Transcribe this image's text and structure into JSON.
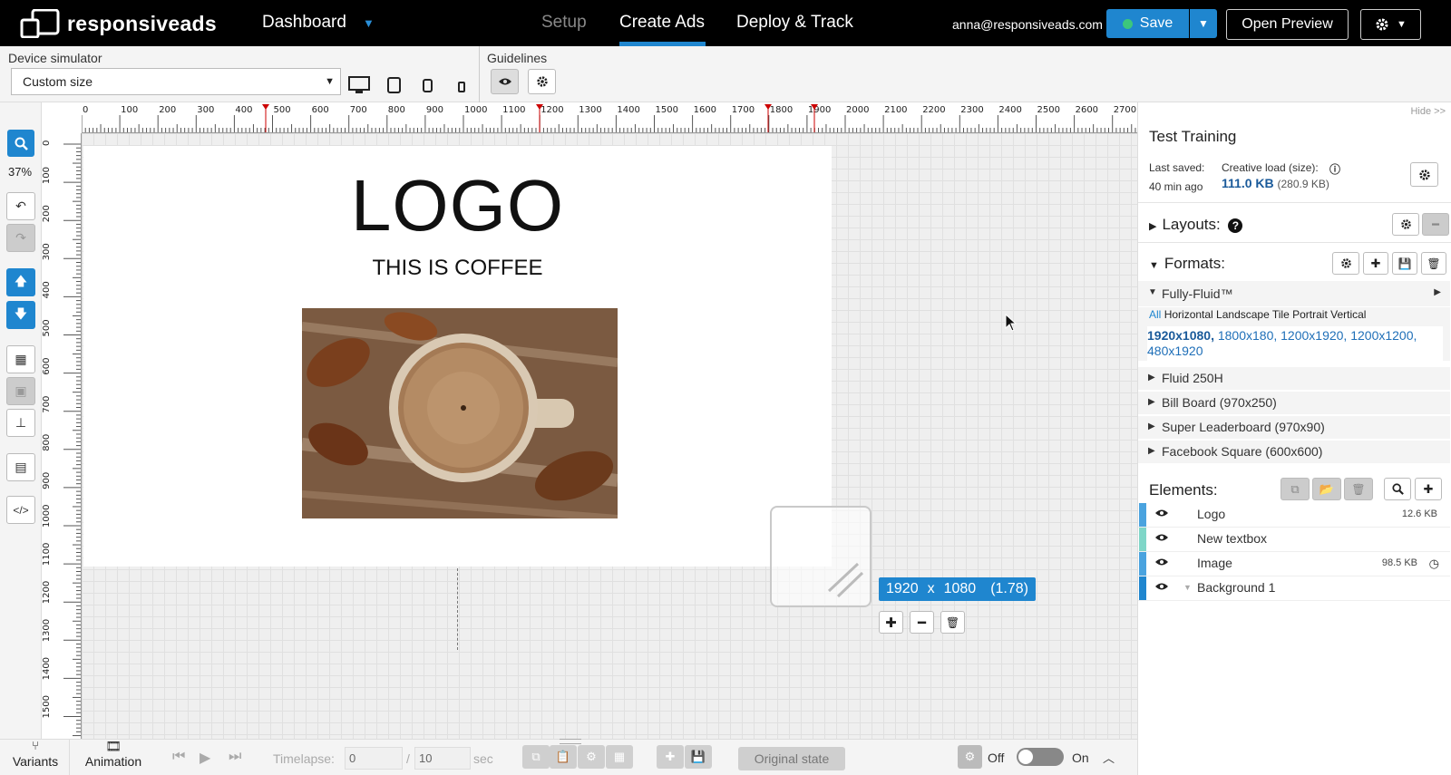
{
  "brand": {
    "name": "responsiveads"
  },
  "topnav": {
    "dashboard": "Dashboard",
    "tabs": [
      {
        "label": "Setup",
        "active": false
      },
      {
        "label": "Create Ads",
        "active": true
      },
      {
        "label": "Deploy & Track",
        "active": false
      }
    ],
    "email": "anna@responsiveads.com",
    "save": "Save",
    "open_preview": "Open Preview"
  },
  "toolbar": {
    "device_label": "Device simulator",
    "device_value": "Custom size",
    "guidelines_label": "Guidelines",
    "devices": [
      "desktop-icon",
      "tablet-icon",
      "phone-icon",
      "small-phone-icon"
    ]
  },
  "left_tools": {
    "zoom": "37%"
  },
  "ruler": {
    "top_ticks": [
      "0",
      "100",
      "200",
      "300",
      "400",
      "500",
      "600",
      "700",
      "800",
      "900",
      "1000",
      "1100",
      "1200",
      "1300",
      "1400",
      "1500",
      "1600",
      "1700",
      "1800",
      "1900",
      "2000",
      "2100",
      "2200",
      "2300",
      "2400",
      "2500",
      "2600",
      "2700"
    ],
    "left_ticks": [
      "0",
      "100",
      "200",
      "300",
      "400",
      "500",
      "600",
      "700",
      "800",
      "900",
      "1000",
      "1100",
      "1200",
      "1300",
      "1400",
      "1500"
    ]
  },
  "canvas": {
    "logo_text": "LOGO",
    "tagline": "THIS IS COFFEE",
    "size_w": "1920",
    "size_x": "x",
    "size_h": "1080",
    "ratio": "(1.78)"
  },
  "panel": {
    "hide": "Hide >>",
    "title": "Test Training",
    "last_saved_label": "Last saved:",
    "last_saved_value": "40 min ago",
    "load_label": "Creative load (size):",
    "load_value": "111.0 KB",
    "load_raw": "(280.9 KB)",
    "layouts": "Layouts:",
    "formats": "Formats:",
    "selected_format": "Fully-Fluid™",
    "categories_all": "All",
    "categories_rest": "Horizontal Landscape Tile Portrait Vertical",
    "sizes_bold": "1920x1080,",
    "sizes_rest": "1800x180, 1200x1920, 1200x1200, 480x1920",
    "format_items": [
      "Fluid 250H",
      "Bill Board (970x250)",
      "Super Leaderboard (970x90)",
      "Facebook Square (600x600)"
    ],
    "elements_label": "Elements:",
    "elements": [
      {
        "name": "Logo",
        "size": "12.6 KB",
        "color": "#4aa3df"
      },
      {
        "name": "New textbox",
        "size": "",
        "color": "#7fd6c8"
      },
      {
        "name": "Image",
        "size": "98.5 KB",
        "color": "#4aa3df"
      },
      {
        "name": "Background 1",
        "size": "",
        "color": "#1f86cf"
      }
    ]
  },
  "bottom": {
    "variants": "Variants",
    "animation": "Animation",
    "timelapse": "Timelapse:",
    "start": "0",
    "slash": "/",
    "end": "10",
    "unit": "sec",
    "original_state": "Original state",
    "off": "Off",
    "on": "On"
  }
}
